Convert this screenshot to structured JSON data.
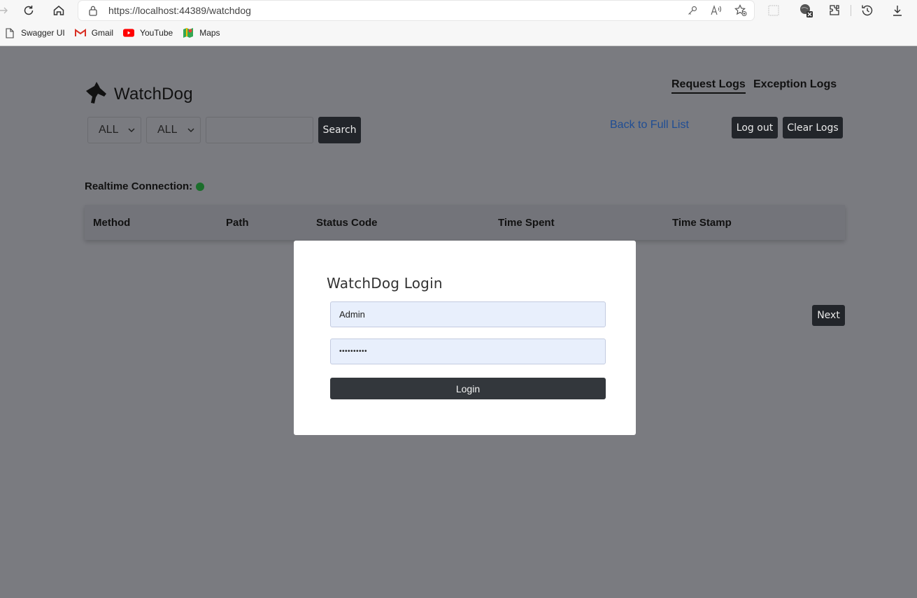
{
  "browser": {
    "url": "https://localhost:44389/watchdog",
    "bookmarks": [
      {
        "label": "Swagger UI",
        "icon": "page-icon"
      },
      {
        "label": "Gmail",
        "icon": "gmail-icon"
      },
      {
        "label": "YouTube",
        "icon": "youtube-icon"
      },
      {
        "label": "Maps",
        "icon": "maps-icon"
      }
    ]
  },
  "app": {
    "brand": "WatchDog",
    "nav": {
      "request_logs": "Request Logs",
      "exception_logs": "Exception Logs"
    },
    "filters": {
      "method_value": "ALL",
      "status_value": "ALL",
      "search_value": ""
    },
    "buttons": {
      "search": "Search",
      "back": "Back to Full List",
      "logout": "Log out",
      "clear": "Clear Logs",
      "next": "Next"
    },
    "realtime_label": "Realtime Connection:",
    "table": {
      "columns": [
        "Method",
        "Path",
        "Status Code",
        "Time Spent",
        "Time Stamp"
      ]
    }
  },
  "modal": {
    "title": "WatchDog Login",
    "username": "Admin",
    "password_mask": "••••••••••",
    "login": "Login"
  },
  "colors": {
    "realtime_dot": "#1b6e2b",
    "dark_button": "#22252a",
    "link": "#1f4d94"
  }
}
